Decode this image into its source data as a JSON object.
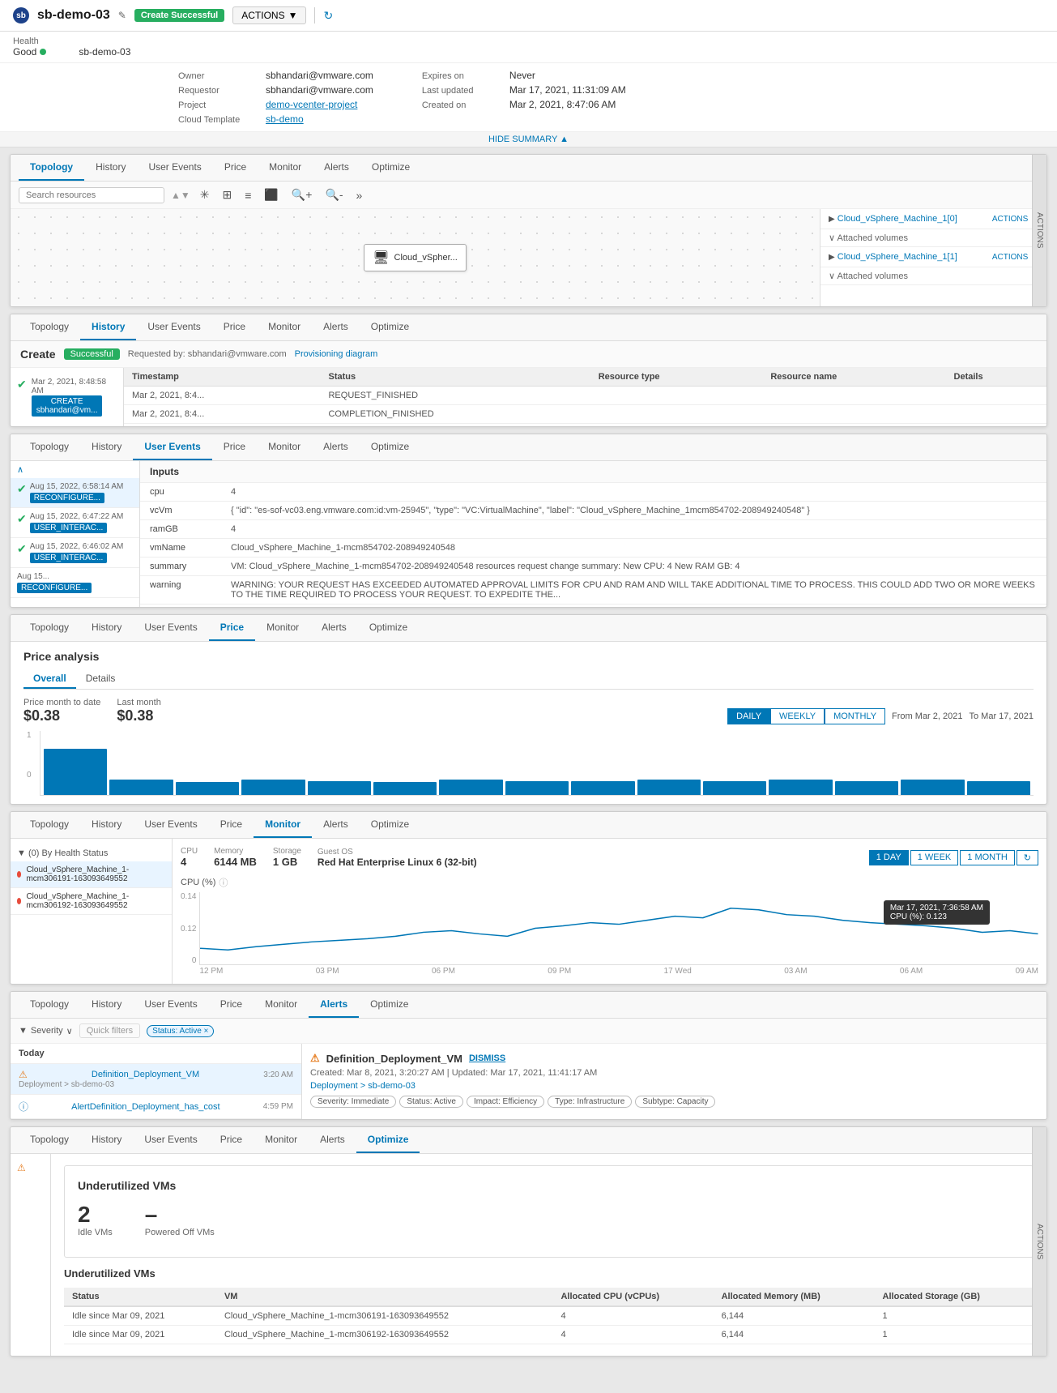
{
  "header": {
    "logo_text": "sb",
    "deployment_name": "sb-demo-03",
    "badge_label": "Create Successful",
    "actions_label": "ACTIONS",
    "edit_tooltip": "Edit",
    "health_label": "Health",
    "health_value": "Good",
    "deployment_id": "sb-demo-03"
  },
  "summary": {
    "owner_label": "Owner",
    "owner_value": "sbhandari@vmware.com",
    "requestor_label": "Requestor",
    "requestor_value": "sbhandari@vmware.com",
    "project_label": "Project",
    "project_value": "demo-vcenter-project",
    "cloud_template_label": "Cloud Template",
    "cloud_template_value": "sb-demo",
    "expires_label": "Expires on",
    "expires_value": "Never",
    "last_updated_label": "Last updated",
    "last_updated_value": "Mar 17, 2021, 11:31:09 AM",
    "created_label": "Created on",
    "created_value": "Mar 2, 2021, 8:47:06 AM",
    "hide_summary_label": "HIDE SUMMARY ▲"
  },
  "tabs": {
    "items": [
      "Topology",
      "History",
      "User Events",
      "Price",
      "Monitor",
      "Alerts",
      "Optimize"
    ]
  },
  "topology_panel": {
    "tab_active": "Topology",
    "search_placeholder": "Search resources",
    "canvas_vm_label": "Cloud_vSpher...",
    "resources": [
      {
        "label": "Cloud_vSphere_Machine_1[0]",
        "actions": "ACTIONS ▼",
        "attached": "Attached volumes"
      },
      {
        "label": "Cloud_vSphere_Machine_1[1]",
        "actions": "ACTIONS ▼",
        "attached": "Attached volumes"
      }
    ],
    "sidebar_label": "ACTIONS"
  },
  "history_panel": {
    "tab_active": "History",
    "create_label": "Create",
    "badge_label": "Successful",
    "requested_by": "Requested by: sbhandari@vmware.com",
    "prov_diagram": "Provisioning diagram",
    "events": [
      {
        "date": "Mar 2, 2021, 8:48:58 AM",
        "btn_label": "CREATE",
        "btn_sub": "sbhandari@vm..."
      }
    ],
    "table_headers": [
      "Timestamp",
      "Status",
      "Resource type",
      "Resource name",
      "Details"
    ],
    "table_rows": [
      [
        "Mar 2, 2021, 8:4...",
        "REQUEST_FINISHED",
        "",
        "",
        ""
      ],
      [
        "Mar 2, 2021, 8:4...",
        "COMPLETION_FINISHED",
        "",
        "",
        ""
      ]
    ]
  },
  "user_events_panel": {
    "tab_active": "User Events",
    "events": [
      {
        "date": "Aug 15, 2022, 6:58:14 AM",
        "btn_label": "RECONFIGURE...",
        "selected": true
      },
      {
        "date": "Aug 15, 2022, 6:47:22 AM",
        "btn_label": "USER_INTERAC..."
      },
      {
        "date": "Aug 15, 2022, 6:46:02 AM",
        "btn_label": "USER_INTERAC..."
      },
      {
        "date": "Aug 15...",
        "btn_label": "RECONFIGURE..."
      }
    ],
    "inputs_header": "Inputs",
    "inputs": [
      {
        "key": "cpu",
        "value": "4"
      },
      {
        "key": "vcVm",
        "value": "{ \"id\": \"es-sof-vc03.eng.vmware.com:id:vm-25945\", \"type\": \"VC:VirtualMachine\", \"label\": \"Cloud_vSphere_Machine_1mcm854702-208949240548\" }"
      },
      {
        "key": "ramGB",
        "value": "4"
      },
      {
        "key": "vmName",
        "value": "Cloud_vSphere_Machine_1-mcm854702-208949240548"
      },
      {
        "key": "summary",
        "value": "VM: Cloud_vSphere_Machine_1-mcm854702-208949240548 resources request change summary: New CPU: 4 New RAM GB: 4"
      },
      {
        "key": "warning",
        "value": "WARNING: YOUR REQUEST HAS EXCEEDED AUTOMATED APPROVAL LIMITS FOR CPU AND RAM AND WILL TAKE ADDITIONAL TIME TO PROCESS. THIS COULD ADD TWO OR MORE WEEKS TO THE TIME REQUIRED TO PROCESS YOUR REQUEST. TO EXPEDITE THE..."
      }
    ]
  },
  "price_panel": {
    "tab_active": "Price",
    "analysis_label": "Price analysis",
    "sub_tabs": [
      "Overall",
      "Details"
    ],
    "sub_tab_active": "Overall",
    "price_month_label": "Price month to date",
    "price_month_value": "$0.38",
    "last_month_label": "Last month",
    "last_month_value": "$0.38",
    "period_btns": [
      "DAILY",
      "WEEKLY",
      "MONTHLY"
    ],
    "active_period": "DAILY",
    "from_label": "From",
    "from_date": "Mar 2, 2021",
    "to_label": "To",
    "to_date": "Mar 17, 2021",
    "chart_bars": [
      0.9,
      0.3,
      0.25,
      0.3,
      0.28,
      0.25,
      0.3,
      0.28,
      0.28,
      0.3,
      0.28,
      0.3,
      0.28,
      0.3,
      0.28
    ],
    "y_axis_top": "1",
    "y_axis_bottom": "0"
  },
  "monitor_panel": {
    "tab_active": "Monitor",
    "filter_label": "▼ (0) By Health Status",
    "vms": [
      {
        "label": "Cloud_vSphere_Machine_1-mcm306191-163093649552",
        "selected": true
      },
      {
        "label": "Cloud_vSphere_Machine_1-mcm306192-163093649552"
      }
    ],
    "cpu_label": "CPU",
    "cpu_value": "4",
    "memory_label": "Memory",
    "memory_value": "6144 MB",
    "storage_label": "Storage",
    "storage_value": "1 GB",
    "guest_os_label": "Guest OS",
    "guest_os_value": "Red Hat Enterprise Linux 6 (32-bit)",
    "time_btns": [
      "1 DAY",
      "1 WEEK",
      "1 MONTH"
    ],
    "active_time": "1 DAY",
    "cpu_chart_label": "CPU (%)",
    "cpu_y_max": "0.14",
    "cpu_y_mid": "0.12",
    "x_labels": [
      "12 PM",
      "03 PM",
      "06 PM",
      "09 PM",
      "17 Wed",
      "03 AM",
      "06 AM",
      "09 AM"
    ],
    "tooltip_date": "Mar 17, 2021, 7:36:58 AM",
    "tooltip_value": "CPU (%): 0.123"
  },
  "alerts_panel": {
    "tab_active": "Alerts",
    "severity_label": "Severity",
    "quick_filters_placeholder": "Quick filters",
    "active_filter": "Status: Active ×",
    "section_today": "Today",
    "alerts": [
      {
        "name": "Definition_Deployment_VM",
        "time": "3:20 AM",
        "sub": "Deployment > sb-demo-03",
        "type": "warn",
        "selected": true
      },
      {
        "name": "AlertDefinition_Deployment_has_cost",
        "time": "4:59 PM",
        "sub": "",
        "type": "info"
      }
    ],
    "detail": {
      "title": "Definition_Deployment_VM",
      "dismiss_label": "DISMISS",
      "created": "Created: Mar 8, 2021, 3:20:27 AM",
      "updated": "Updated: Mar 17, 2021, 11:41:17 AM",
      "breadcrumb": "Deployment > sb-demo-03",
      "tags": [
        "Severity: Immediate",
        "Status: Active",
        "Impact: Efficiency",
        "Type: Infrastructure",
        "Subtype: Capacity"
      ]
    }
  },
  "optimize_panel": {
    "tab_active": "Optimize",
    "card_title": "Underutilized VMs",
    "idle_vms_label": "Idle VMs",
    "idle_vms_value": "2",
    "powered_off_label": "Powered Off VMs",
    "powered_off_value": "–",
    "section_title": "Underutilized VMs",
    "table_headers": [
      "Status",
      "VM",
      "Allocated CPU (vCPUs)",
      "Allocated Memory (MB)",
      "Allocated Storage (GB)"
    ],
    "table_rows": [
      {
        "status": "Idle since Mar 09, 2021",
        "vm": "Cloud_vSphere_Machine_1-mcm306191-163093649552",
        "cpu": "4",
        "memory": "6,144",
        "storage": "1"
      },
      {
        "status": "Idle since Mar 09, 2021",
        "vm": "Cloud_vSphere_Machine_1-mcm306192-163093649552",
        "cpu": "4",
        "memory": "6,144",
        "storage": "1"
      }
    ],
    "sidebar_label": "ACTIONS"
  }
}
